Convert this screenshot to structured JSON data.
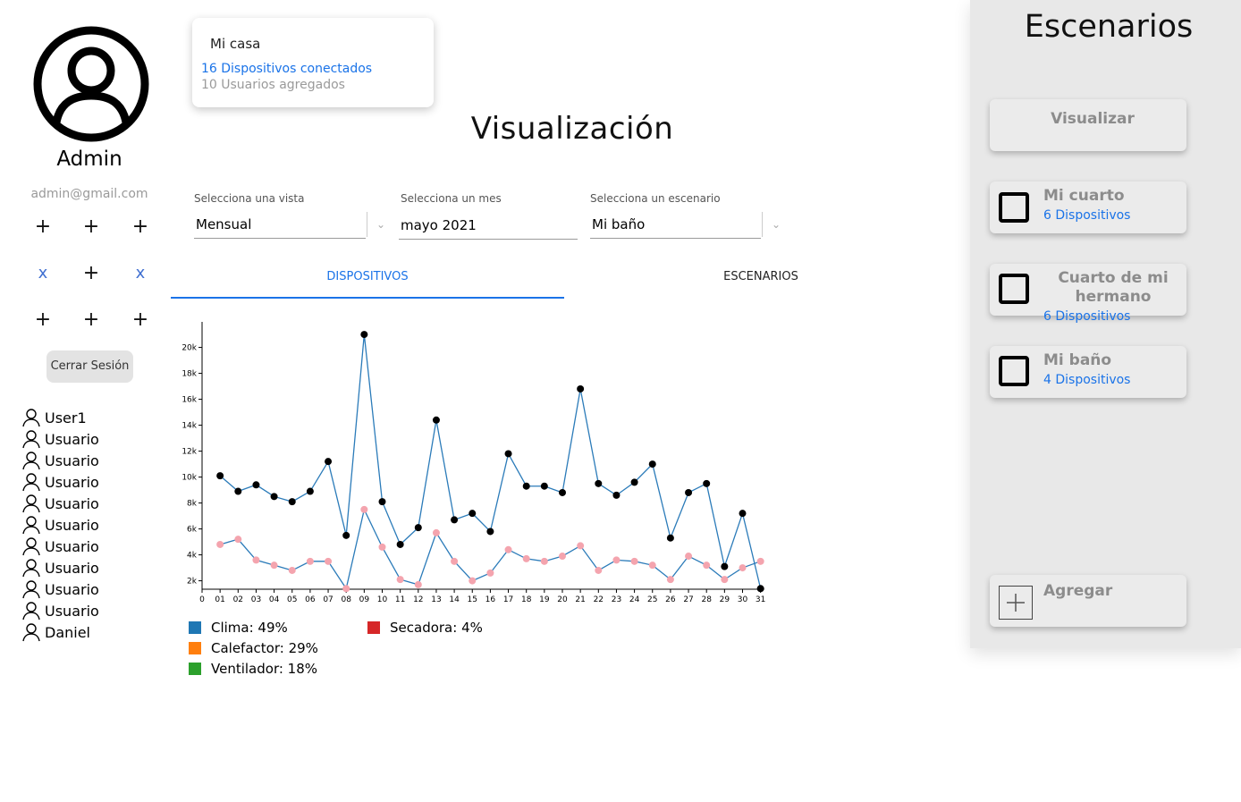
{
  "profile": {
    "name": "Admin",
    "email": "admin@gmail.com",
    "logout_label": "Cerrar Sesión"
  },
  "controls": {
    "grid": [
      "+",
      "+",
      "+",
      "x",
      "+",
      "x",
      "+",
      "+",
      "+"
    ]
  },
  "users": [
    "User1",
    "Usuario",
    "Usuario",
    "Usuario",
    "Usuario",
    "Usuario",
    "Usuario",
    "Usuario",
    "Usuario",
    "Usuario",
    "Daniel"
  ],
  "home": {
    "title": "Mi casa",
    "devices": "16 Dispositivos conectados",
    "users": "10 Usuarios agregados"
  },
  "page_title": "Visualización",
  "filters": {
    "view": {
      "label": "Selecciona una vista",
      "value": "Mensual"
    },
    "month": {
      "label": "Selecciona un mes",
      "value": "mayo 2021"
    },
    "scenario": {
      "label": "Selecciona un escenario",
      "value": "Mi baño"
    }
  },
  "tabs": {
    "devices": "DISPOSITIVOS",
    "scenarios": "ESCENARIOS"
  },
  "legend": [
    {
      "label": "Clima: 49%",
      "color": "#1f77b4"
    },
    {
      "label": "Calefactor: 29%",
      "color": "#ff7f0e"
    },
    {
      "label": "Ventilador: 18%",
      "color": "#2ca02c"
    },
    {
      "label": "Secadora: 4%",
      "color": "#d62728"
    }
  ],
  "chart_data": {
    "type": "line",
    "x": [
      1,
      2,
      3,
      4,
      5,
      6,
      7,
      8,
      9,
      10,
      11,
      12,
      13,
      14,
      15,
      16,
      17,
      18,
      19,
      20,
      21,
      22,
      23,
      24,
      25,
      26,
      27,
      28,
      29,
      30,
      31
    ],
    "x_tick_labels": [
      "0",
      "01",
      "02",
      "03",
      "04",
      "05",
      "06",
      "07",
      "08",
      "09",
      "10",
      "11",
      "12",
      "13",
      "14",
      "15",
      "16",
      "17",
      "18",
      "19",
      "20",
      "21",
      "22",
      "23",
      "24",
      "25",
      "26",
      "27",
      "28",
      "29",
      "30",
      "31"
    ],
    "y_tick_labels": [
      "2k",
      "4k",
      "6k",
      "8k",
      "10k",
      "12k",
      "14k",
      "16k",
      "18k",
      "20k"
    ],
    "ylim": [
      1000,
      21000
    ],
    "series": [
      {
        "color": "#000000",
        "values": [
          10100,
          8900,
          9400,
          8500,
          8100,
          8900,
          11200,
          5500,
          21000,
          8100,
          4800,
          6100,
          14400,
          6700,
          7200,
          5800,
          11800,
          9300,
          9300,
          8800,
          16800,
          9500,
          8600,
          9600,
          11000,
          5300,
          8800,
          9500,
          3100,
          7200,
          1400
        ]
      },
      {
        "color": "#f4a4ae",
        "values": [
          4800,
          5200,
          3600,
          3200,
          2800,
          3500,
          3500,
          1400,
          7500,
          4600,
          2100,
          1700,
          5700,
          3500,
          2000,
          2600,
          4400,
          3700,
          3500,
          3900,
          4700,
          2800,
          3600,
          3500,
          3200,
          2100,
          3900,
          3200,
          2100,
          3000,
          3500
        ]
      }
    ],
    "line_color": "#2b7bb9"
  },
  "scenarios_panel": {
    "title": "Escenarios",
    "visualize_label": "Visualizar",
    "items": [
      {
        "name": "Mi cuarto",
        "count": "6 Dispositivos"
      },
      {
        "name": "Cuarto de mi hermano",
        "count": "6 Dispositivos"
      },
      {
        "name": "Mi baño",
        "count": "4 Dispositivos"
      }
    ],
    "add_label": "Agregar"
  }
}
